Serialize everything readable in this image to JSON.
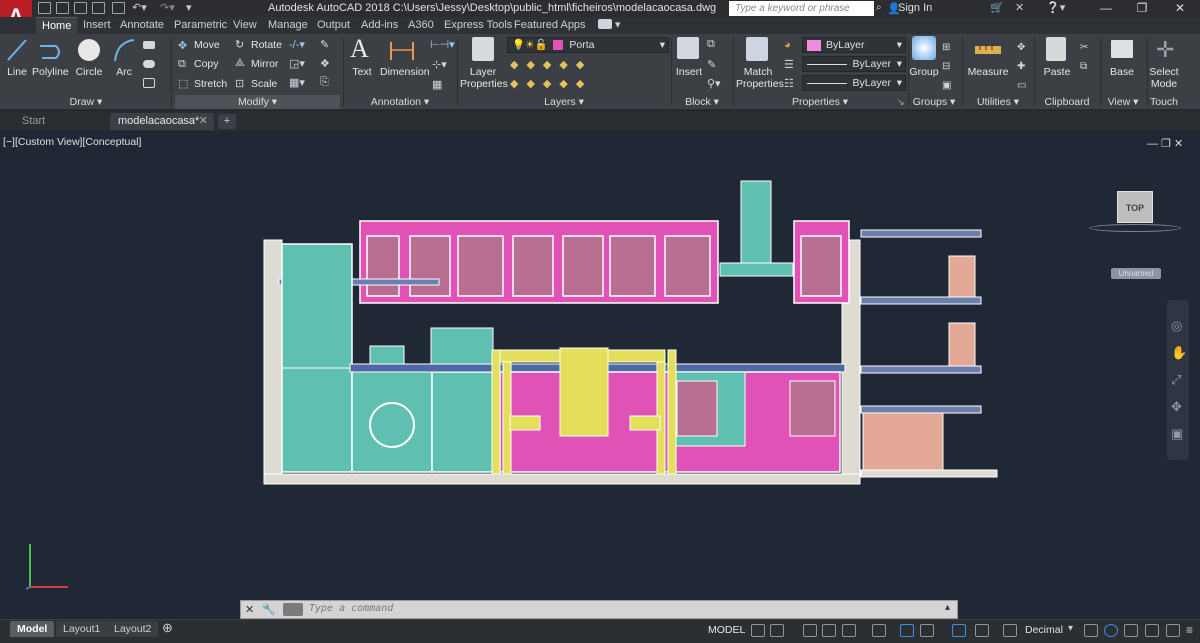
{
  "titlebar": {
    "app_logo": "A",
    "title": "Autodesk AutoCAD 2018    C:\\Users\\Jessy\\Desktop\\public_html\\ficheiros\\modelacaocasa.dwg",
    "search_placeholder": "Type a keyword or phrase",
    "sign_in": "Sign In"
  },
  "ribbon_tabs": [
    "Home",
    "Insert",
    "Annotate",
    "Parametric",
    "View",
    "Manage",
    "Output",
    "Add-ins",
    "A360",
    "Express Tools",
    "Featured Apps"
  ],
  "draw": {
    "line": "Line",
    "polyline": "Polyline",
    "circle": "Circle",
    "arc": "Arc",
    "title": "Draw ▾"
  },
  "modify": {
    "move": "Move",
    "rotate": "Rotate",
    "copy": "Copy",
    "mirror": "Mirror",
    "stretch": "Stretch",
    "scale": "Scale",
    "title": "Modify ▾"
  },
  "annotation": {
    "text": "Text",
    "dimension": "Dimension",
    "title": "Annotation ▾"
  },
  "layers": {
    "layer_properties_1": "Layer",
    "layer_properties_2": "Properties",
    "current_layer": "Porta",
    "title": "Layers ▾"
  },
  "block": {
    "insert": "Insert",
    "title": "Block ▾"
  },
  "properties": {
    "match_1": "Match",
    "match_2": "Properties",
    "color": "ByLayer",
    "linetype": "ByLayer",
    "lineweight": "ByLayer",
    "title": "Properties ▾"
  },
  "groups": {
    "group": "Group",
    "title": "Groups ▾"
  },
  "utilities": {
    "measure": "Measure",
    "title": "Utilities ▾"
  },
  "clipboard": {
    "paste": "Paste",
    "title": "Clipboard"
  },
  "view_panel": {
    "base": "Base",
    "title": "View ▾"
  },
  "touch": {
    "select_1": "Select",
    "select_2": "Mode",
    "title": "Touch"
  },
  "file_tabs": {
    "start": "Start",
    "drawing": "modelacaocasa*",
    "add": "+"
  },
  "viewport": {
    "label": "[−][Custom View][Conceptual]",
    "viewcube_top": "TOP",
    "ucs_name": "Unnamed"
  },
  "command": {
    "placeholder": "Type a command"
  },
  "layouts": [
    "Model",
    "Layout1",
    "Layout2"
  ],
  "status": {
    "model": "MODEL",
    "units": "Decimal"
  },
  "colors": {
    "cabinet_pink": "#e052b6",
    "fridge_teal": "#5fbfb0",
    "chair_yellow": "#e3df5a",
    "wall_white": "#e2dfd8",
    "peach": "#e3a896"
  }
}
